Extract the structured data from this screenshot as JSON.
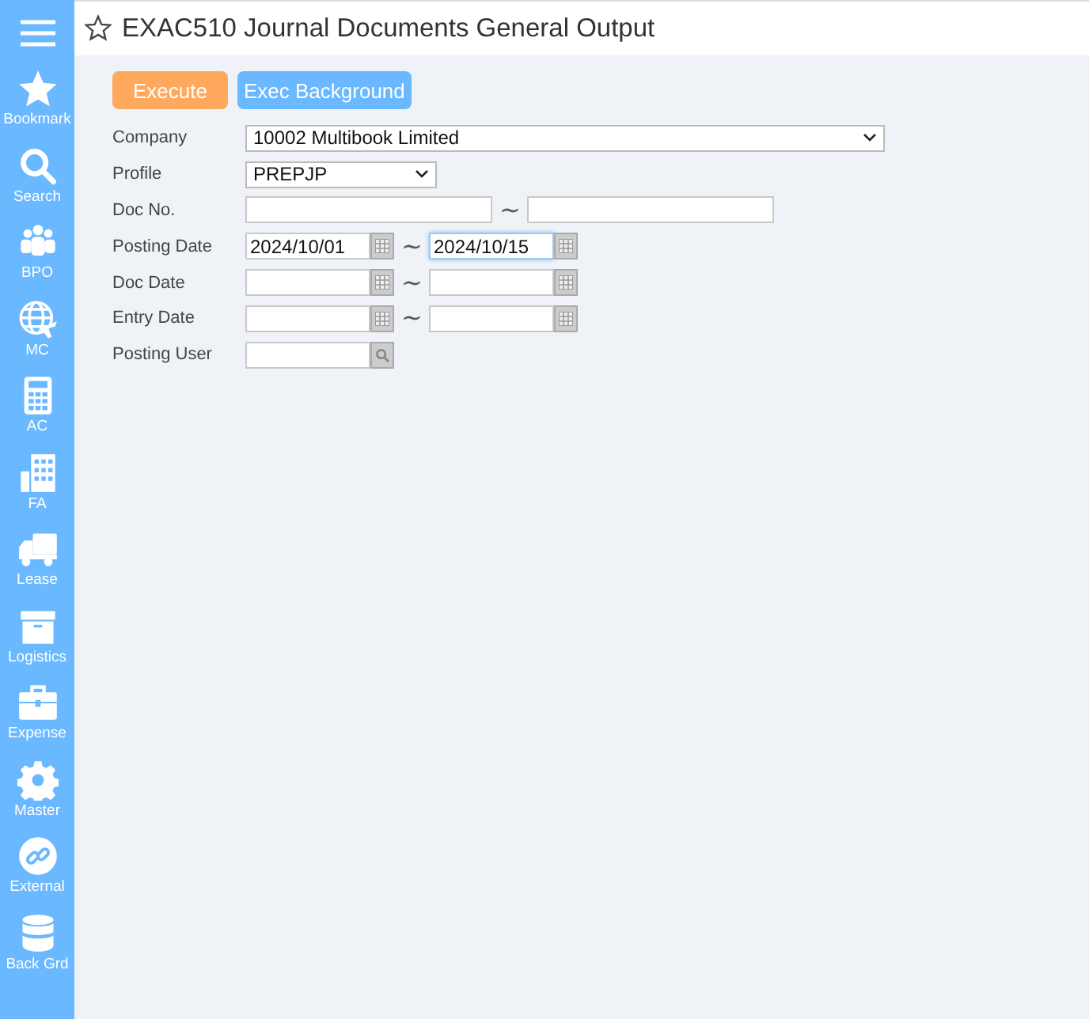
{
  "sidebar": {
    "items": [
      {
        "label": "Bookmark"
      },
      {
        "label": "Search"
      },
      {
        "label": "BPO"
      },
      {
        "label": "MC"
      },
      {
        "label": "AC"
      },
      {
        "label": "FA"
      },
      {
        "label": "Lease"
      },
      {
        "label": "Logistics"
      },
      {
        "label": "Expense"
      },
      {
        "label": "Master"
      },
      {
        "label": "External"
      },
      {
        "label": "Back Grd"
      }
    ]
  },
  "header": {
    "title": "EXAC510 Journal Documents General Output",
    "bookmarked": false
  },
  "buttons": [
    {
      "label": "Execute",
      "kind": "primary"
    },
    {
      "label": "Exec Background",
      "kind": "secondary"
    }
  ],
  "form": [
    {
      "label": "Company",
      "kind": "wide_select",
      "value": "10002 Multibook Limited"
    },
    {
      "label": "Profile",
      "kind": "select",
      "value": "PREPJP"
    },
    {
      "label": "Doc No.",
      "kind": "text_range",
      "separator": "∼",
      "from": {
        "focused": false
      },
      "to": {
        "focused": false
      }
    },
    {
      "label": "Posting Date",
      "kind": "date_range",
      "separator": "∼",
      "from": {
        "value": "2024/10/01",
        "focused": false
      },
      "to": {
        "value": "2024/10/15",
        "focused": true
      }
    },
    {
      "label": "Doc Date",
      "kind": "date_range",
      "separator": "∼",
      "from": {
        "focused": false
      },
      "to": {
        "focused": false
      }
    },
    {
      "label": "Entry Date",
      "kind": "date_range",
      "separator": "∼",
      "from": {
        "focused": false
      },
      "to": {
        "focused": false
      }
    },
    {
      "label": "Posting User",
      "kind": "lookup"
    }
  ]
}
